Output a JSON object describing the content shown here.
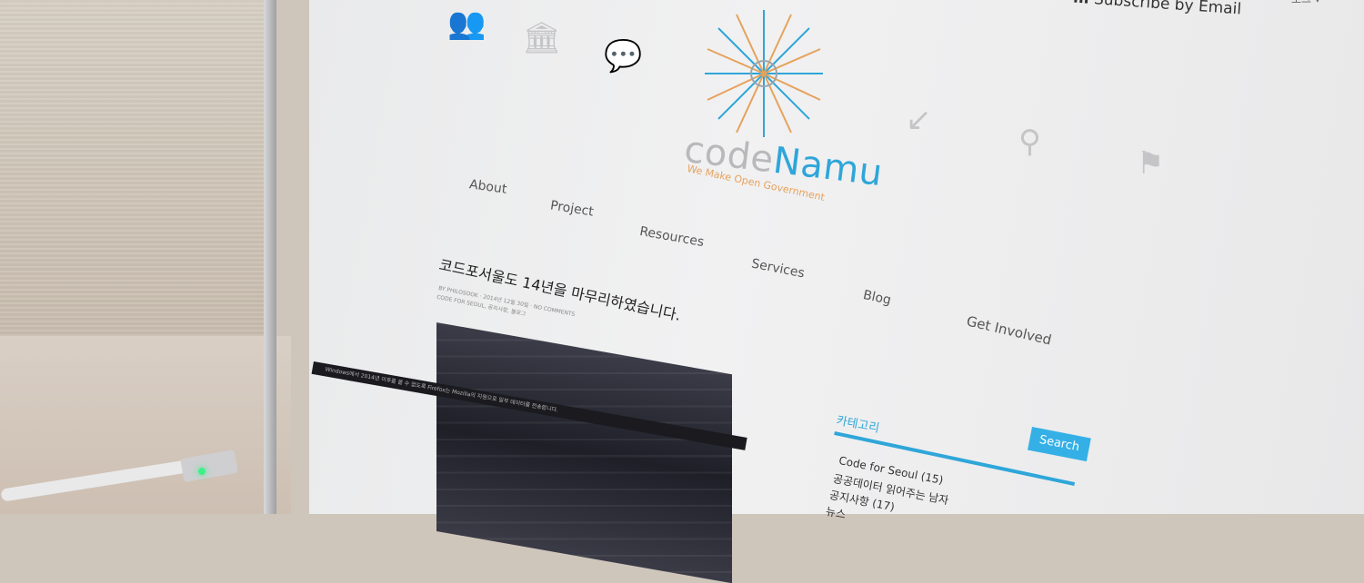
{
  "header": {
    "subscribe_label": "Subscribe by Email",
    "subscribe_icon": "rss-icon",
    "top_right_label": "로그"
  },
  "brand": {
    "name_part1": "code",
    "name_part2": "Namu",
    "tagline": "We Make Open Government",
    "accent_color": "#2fa6d9",
    "tagline_color": "#e6a25c"
  },
  "icons": [
    "people-icon",
    "bank-icon",
    "chat-icon",
    "chart-icon",
    "search-icon",
    "flag-icon"
  ],
  "nav": {
    "items": [
      "About",
      "Project",
      "Resources",
      "Services",
      "Blog",
      "Get Involved"
    ]
  },
  "post": {
    "title": "코드포서울도 14년을 마무리하였습니다.",
    "meta_line1": "BY PHILOSOOK · 2014년 12월 30일 · NO COMMENTS",
    "meta_line2": "CODE FOR SEOUL, 공지사항, 블로그"
  },
  "taskbar": {
    "text": "Windows에서 2014년 이후를 볼 수 없도록 Firefox는 Mozilla의 지원으로 일부 데이터를 전송합니다."
  },
  "sidebar": {
    "category_title": "카테고리",
    "search_button": "Search",
    "categories": [
      "Code for Seoul (15)",
      "공공데이터 읽어주는 남자",
      "공지사항 (17)",
      "뉴스"
    ]
  }
}
